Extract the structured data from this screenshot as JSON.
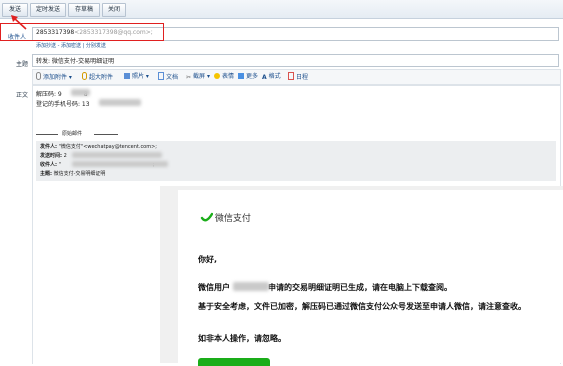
{
  "toolbar": {
    "send": "发送",
    "scheduled_send": "定时发送",
    "save_draft": "存草稿",
    "close": "关闭"
  },
  "recipient": {
    "label": "收件人",
    "value": "2853317398",
    "value_suffix": "<2853317398@qq.com>;",
    "add_cc": "添加抄送",
    "add_bcc": "添加密送",
    "separate_send": "分别发送"
  },
  "subject": {
    "label": "主题",
    "value": "转发: 微信支付-交易明细证明"
  },
  "editor_toolbar": {
    "add_attachment": "添加附件",
    "large_attachment": "超大附件",
    "photo": "照片",
    "document": "文档",
    "screenshot": "截屏",
    "emoji": "表情",
    "more": "更多",
    "format": "格式",
    "calendar": "日程"
  },
  "body": {
    "label": "正文",
    "unzip_code_label": "解压码: 9",
    "unzip_code_tail": "8",
    "phone_label": "登记的手机号码: 13",
    "original_mail_divider": "原始邮件",
    "orig_from_label": "发件人:",
    "orig_from_value": "\"微信支付\"<wechatpay@tencent.com>;",
    "orig_time_label": "发送时间:",
    "orig_time_value": "2",
    "orig_to_label": "收件人:",
    "orig_to_value": "\"",
    "orig_to_tail": ";",
    "orig_subject_label": "主题:",
    "orig_subject_value": "微信支付-交易明细证明"
  },
  "wechat_mail": {
    "brand": "微信支付",
    "greeting": "你好,",
    "line1_pre": "微信用户",
    "line1_post": "申请的交易明细证明已生成，请在电脑上下载查阅。",
    "line2": "基于安全考虑，文件已加密，解压码已通过微信支付公众号发送至申请人微信，请注意查收。",
    "line3": "如非本人操作，请忽略。"
  },
  "colors": {
    "highlight_red": "#e02020",
    "wechat_green": "#1aad19",
    "link_blue": "#1b4e8c"
  }
}
